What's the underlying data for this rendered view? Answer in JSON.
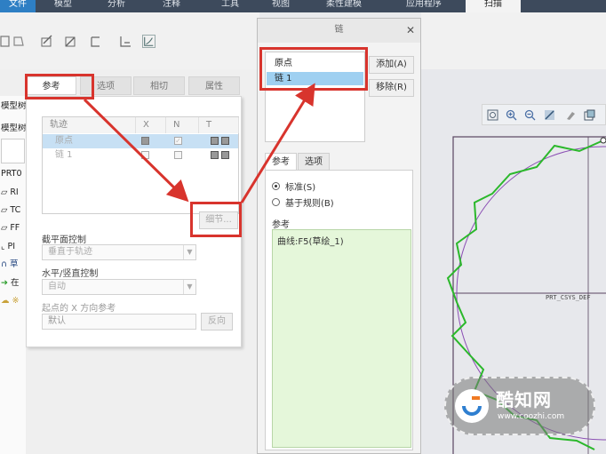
{
  "ribbon": {
    "tabs": [
      "文件",
      "模型",
      "分析",
      "注释",
      "工具",
      "视图",
      "柔性建模",
      "应用程序",
      "扫描"
    ],
    "colors": {
      "bar": "#3d4a5c",
      "active": "#f3f3f3"
    }
  },
  "dashboard": {
    "tabs": [
      "参考",
      "选项",
      "相切",
      "属性"
    ],
    "active_tab": "参考"
  },
  "model_tree": {
    "header": "模型树",
    "filter_label": "模型树",
    "items": [
      "PRT0",
      "RI",
      "TC",
      "FF",
      "PI",
      "草",
      "在",
      "※"
    ]
  },
  "references_panel": {
    "table_headers": [
      "轨迹",
      "X",
      "N",
      "T"
    ],
    "rows": [
      {
        "name": "原点",
        "x": "checked",
        "n": "checked",
        "t": "checked",
        "selected": true
      },
      {
        "name": "链 1",
        "x": "unchecked",
        "n": "unchecked",
        "t": "checked",
        "selected": false
      }
    ],
    "details_button": "细节...",
    "section_plane_label": "截平面控制",
    "section_plane_value": "垂直于轨迹",
    "hv_control_label": "水平/竖直控制",
    "hv_control_value": "自动",
    "x_dir_label": "起点的 X 方向参考",
    "x_dir_value": "默认",
    "flip_button": "反向"
  },
  "chain_dialog": {
    "title": "链",
    "close_icon": "close-icon",
    "list_items": [
      "原点",
      "链 1"
    ],
    "selected_item": "链 1",
    "add_button": "添加(A)",
    "remove_button": "移除(R)",
    "tabs": [
      "参考",
      "选项"
    ],
    "active_tab": "参考",
    "radio_standard": "标准(S)",
    "radio_rule": "基于规则(B)",
    "radio_selected": "标准(S)",
    "reference_label": "参考",
    "reference_value": "曲线:F5(草绘_1)"
  },
  "graphics": {
    "csys_label": "PRT_CSYS_DEF",
    "colors": {
      "curve": "#2bb82b",
      "circle": "#8a4db3",
      "frame": "#5a4560",
      "highlight": "#d8342d"
    }
  },
  "watermark": {
    "text": "酷知网",
    "url": "www.coozhi.com"
  }
}
